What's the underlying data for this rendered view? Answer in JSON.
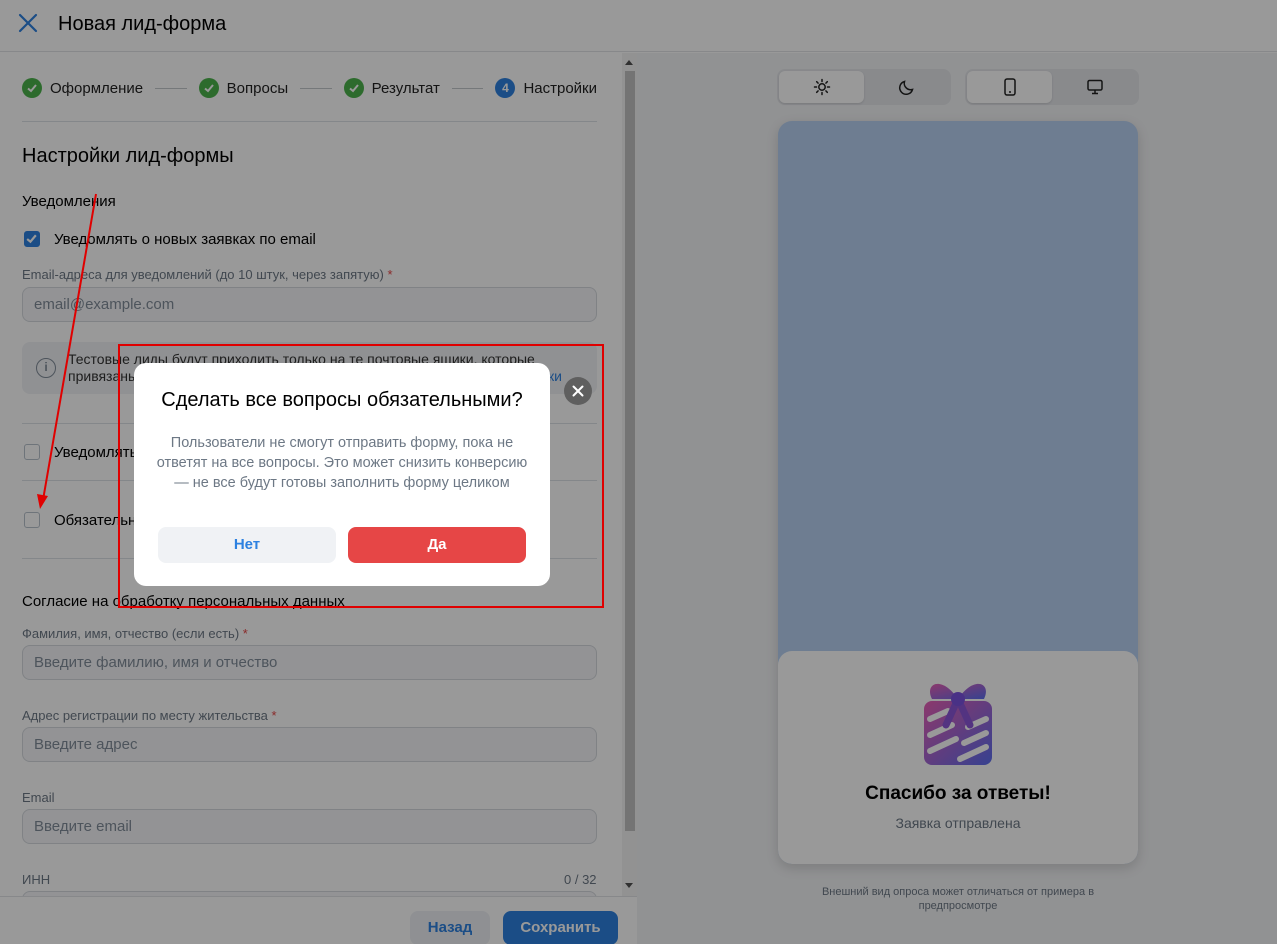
{
  "header": {
    "title": "Новая лид-форма"
  },
  "steps": [
    {
      "label": "Оформление",
      "state": "done"
    },
    {
      "label": "Вопросы",
      "state": "done"
    },
    {
      "label": "Результат",
      "state": "done"
    },
    {
      "label": "Настройки",
      "state": "current",
      "number": "4"
    }
  ],
  "settings": {
    "title": "Настройки лид-формы",
    "notifications_title": "Уведомления",
    "notify_email_label": "Уведомлять о новых заявках по email",
    "notify_email_checked": true,
    "email_field_label": "Email-адреса для уведомлений (до 10 штук, через запятую)",
    "required_mark": "*",
    "email_placeholder": "email@example.com",
    "info_line1": "Тестовые лиды будут приходить только на те почтовые ящики, которые",
    "info_line2": "привязаны",
    "info_link": "ки",
    "notify_other_label": "Уведомлять",
    "required_label": "Обязательны",
    "consent_title": "Согласие на обработку персональных данных",
    "fio_label": "Фамилия, имя, отчество (если есть)",
    "fio_placeholder": "Введите фамилию, имя и отчество",
    "address_label": "Адрес регистрации по месту жительства",
    "address_placeholder": "Введите адрес",
    "email_label": "Email",
    "email2_placeholder": "Введите email",
    "inn_label": "ИНН",
    "inn_counter": "0 / 32"
  },
  "footer": {
    "back": "Назад",
    "save": "Сохранить"
  },
  "preview": {
    "theme_options": [
      "light-theme-icon",
      "dark-theme-icon"
    ],
    "device_options": [
      "mobile-icon",
      "desktop-icon"
    ],
    "thanks": "Спасибо за ответы!",
    "sent": "Заявка отправлена",
    "note": "Внешний вид опроса может отличаться от примера в предпросмотре"
  },
  "modal": {
    "title": "Сделать все вопросы обязательными?",
    "text": "Пользователи не смогут отправить форму, пока не ответят на все вопросы. Это может снизить конверсию — не все будут готовы заполнить форму целиком",
    "no": "Нет",
    "yes": "Да"
  },
  "colors": {
    "accent": "#2d81e0",
    "danger": "#e64646",
    "success": "#4bb34b",
    "annotation": "#e00000"
  }
}
